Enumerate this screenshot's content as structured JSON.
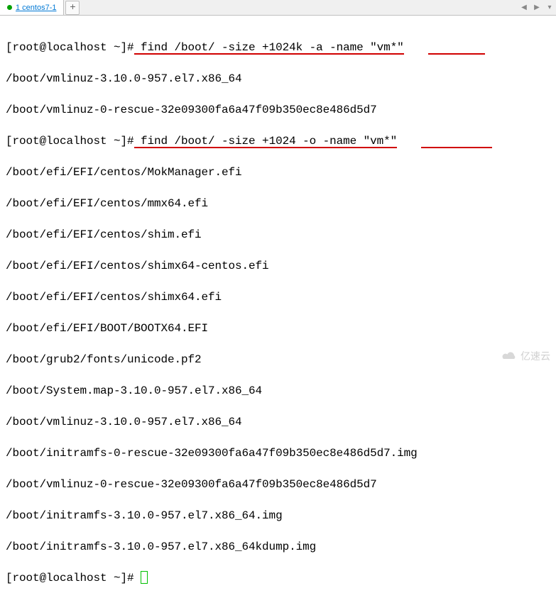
{
  "tab": {
    "label": "1 centos7-1"
  },
  "add_tab": "+",
  "nav": {
    "prev": "◀",
    "next": "▶",
    "menu": "▾"
  },
  "term": {
    "prompt1_pre": "[root@localhost ~]#",
    "cmd1": " find /boot/ -size +1024k -a -name \"vm*\"",
    "out1": "/boot/vmlinuz-3.10.0-957.el7.x86_64",
    "out2": "/boot/vmlinuz-0-rescue-32e09300fa6a47f09b350ec8e486d5d7",
    "prompt2_pre": "[root@localhost ~]#",
    "cmd2": " find /boot/ -size +1024 -o -name \"vm*\"",
    "out3": "/boot/efi/EFI/centos/MokManager.efi",
    "out4": "/boot/efi/EFI/centos/mmx64.efi",
    "out5": "/boot/efi/EFI/centos/shim.efi",
    "out6": "/boot/efi/EFI/centos/shimx64-centos.efi",
    "out7": "/boot/efi/EFI/centos/shimx64.efi",
    "out8": "/boot/efi/EFI/BOOT/BOOTX64.EFI",
    "out9": "/boot/grub2/fonts/unicode.pf2",
    "out10": "/boot/System.map-3.10.0-957.el7.x86_64",
    "out11": "/boot/vmlinuz-3.10.0-957.el7.x86_64",
    "out12": "/boot/initramfs-0-rescue-32e09300fa6a47f09b350ec8e486d5d7.img",
    "out13": "/boot/vmlinuz-0-rescue-32e09300fa6a47f09b350ec8e486d5d7",
    "out14": "/boot/initramfs-3.10.0-957.el7.x86_64.img",
    "out15": "/boot/initramfs-3.10.0-957.el7.x86_64kdump.img",
    "prompt3": "[root@localhost ~]# "
  },
  "watermark": "亿速云"
}
